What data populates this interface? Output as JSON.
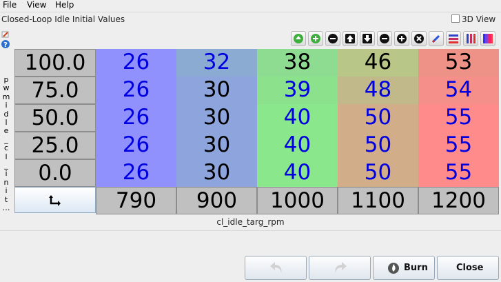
{
  "menu": {
    "file": "File",
    "view": "View",
    "help": "Help"
  },
  "window": {
    "title": "Closed-Loop Idle Initial Values",
    "view3d_label": "3D View"
  },
  "y_axis": {
    "name": "pwm idle_cl_init...",
    "letters": [
      "p",
      "w",
      "m",
      "i",
      "d",
      "l",
      "e",
      "_",
      "c",
      "l",
      "_",
      "i",
      "n",
      "i",
      "t",
      "…"
    ],
    "values": [
      "100.0",
      "75.0",
      "50.0",
      "25.0",
      "0.0"
    ]
  },
  "x_axis": {
    "name": "cl_idle_targ_rpm",
    "values": [
      "790",
      "900",
      "1000",
      "1100",
      "1200"
    ]
  },
  "table": [
    [
      "26",
      "32",
      "38",
      "46",
      "53"
    ],
    [
      "26",
      "30",
      "39",
      "48",
      "54"
    ],
    [
      "26",
      "30",
      "40",
      "50",
      "55"
    ],
    [
      "26",
      "30",
      "40",
      "50",
      "55"
    ],
    [
      "26",
      "30",
      "40",
      "50",
      "55"
    ]
  ],
  "cell_colors": [
    [
      "#9191fd",
      "#8cabd3",
      "#8edb92",
      "#b8c788",
      "#ee9288"
    ],
    [
      "#9191fd",
      "#8ea4dc",
      "#8ce18d",
      "#c2b98a",
      "#f48f89"
    ],
    [
      "#9191fd",
      "#8ea4dc",
      "#8be78c",
      "#d2ad8a",
      "#ff8b8b"
    ],
    [
      "#9191fd",
      "#8ea4dc",
      "#8be78c",
      "#d2ad8a",
      "#ff8b8b"
    ],
    [
      "#9191fd",
      "#8ea4dc",
      "#8be78c",
      "#d2ad8a",
      "#ff8b8b"
    ]
  ],
  "cell_text_colors": [
    [
      "#0000e0",
      "#0000e0",
      "#000000",
      "#000000",
      "#000000"
    ],
    [
      "#0000e0",
      "#000000",
      "#0000e0",
      "#0000e0",
      "#0000e0"
    ],
    [
      "#0000e0",
      "#000000",
      "#0000e0",
      "#0000e0",
      "#0000e0"
    ],
    [
      "#0000e0",
      "#000000",
      "#0000e0",
      "#0000e0",
      "#0000e0"
    ],
    [
      "#0000e0",
      "#000000",
      "#0000e0",
      "#0000e0",
      "#0000e0"
    ]
  ],
  "buttons": {
    "burn": "Burn",
    "close": "Close"
  },
  "toolbar_icons": [
    "increment-icon",
    "increment-more-icon",
    "decrement-icon",
    "shift-up-icon",
    "shift-down-icon",
    "minus-icon",
    "plus-icon",
    "multiply-icon",
    "edit-icon",
    "horizontal-interpolate-icon",
    "vertical-interpolate-icon",
    "color-scale-icon"
  ]
}
